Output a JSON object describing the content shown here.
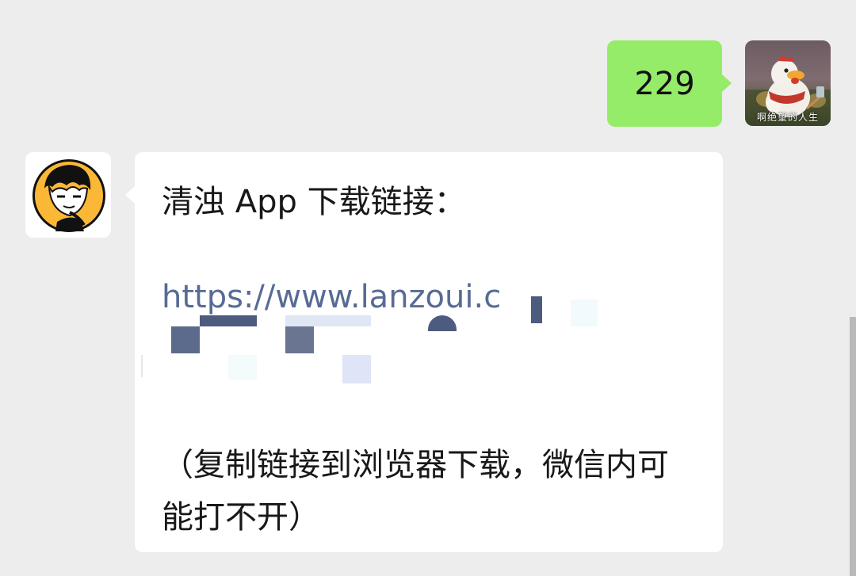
{
  "messages": [
    {
      "side": "outgoing",
      "text": "229",
      "avatar": {
        "caption": "啊绝望的人生",
        "icon": "chick-mascot-avatar-icon"
      }
    },
    {
      "side": "incoming",
      "avatar": {
        "icon": "cartoon-boy-avatar-icon"
      },
      "title": "清浊 App 下载链接：",
      "link": "https://www.lanzoui.c",
      "note_line1": "（复制链接到浏览器下载，微信内可",
      "note_line2": "能打不开）"
    }
  ],
  "colors": {
    "background": "#ededed",
    "outgoing_bubble": "#95ec69",
    "incoming_bubble": "#ffffff",
    "link": "#576b95"
  }
}
